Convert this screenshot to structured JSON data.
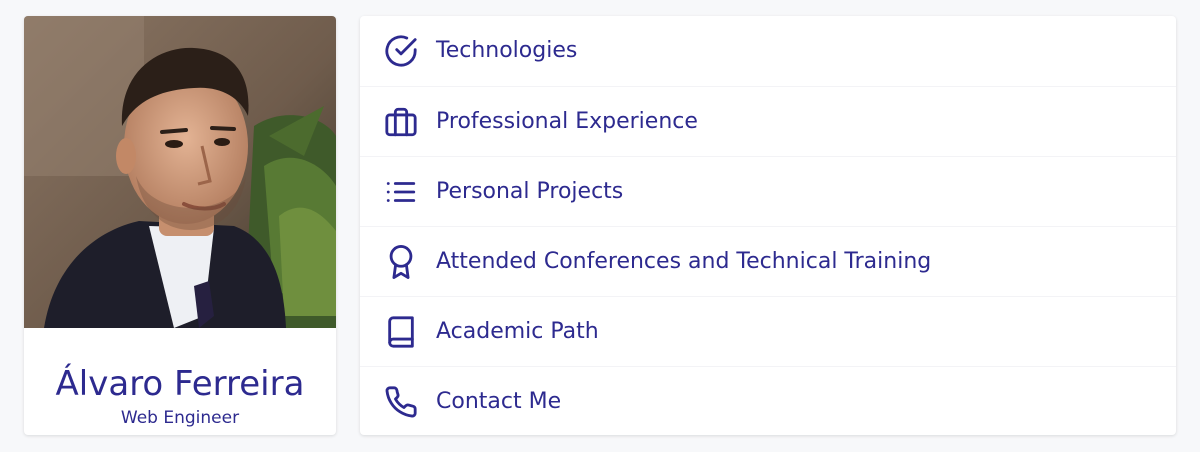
{
  "profile": {
    "name": "Álvaro Ferreira",
    "role": "Web Engineer",
    "photo_alt": "Álvaro Ferreira"
  },
  "theme": {
    "accent": "#2d2a8f",
    "background": "#f7f8fa",
    "card": "#ffffff"
  },
  "nav": {
    "items": [
      {
        "label": "Technologies",
        "icon": "check-circle-icon"
      },
      {
        "label": "Professional Experience",
        "icon": "briefcase-icon"
      },
      {
        "label": "Personal Projects",
        "icon": "list-icon"
      },
      {
        "label": "Attended Conferences and Technical Training",
        "icon": "award-icon"
      },
      {
        "label": "Academic Path",
        "icon": "book-icon"
      },
      {
        "label": "Contact Me",
        "icon": "phone-icon"
      }
    ]
  }
}
